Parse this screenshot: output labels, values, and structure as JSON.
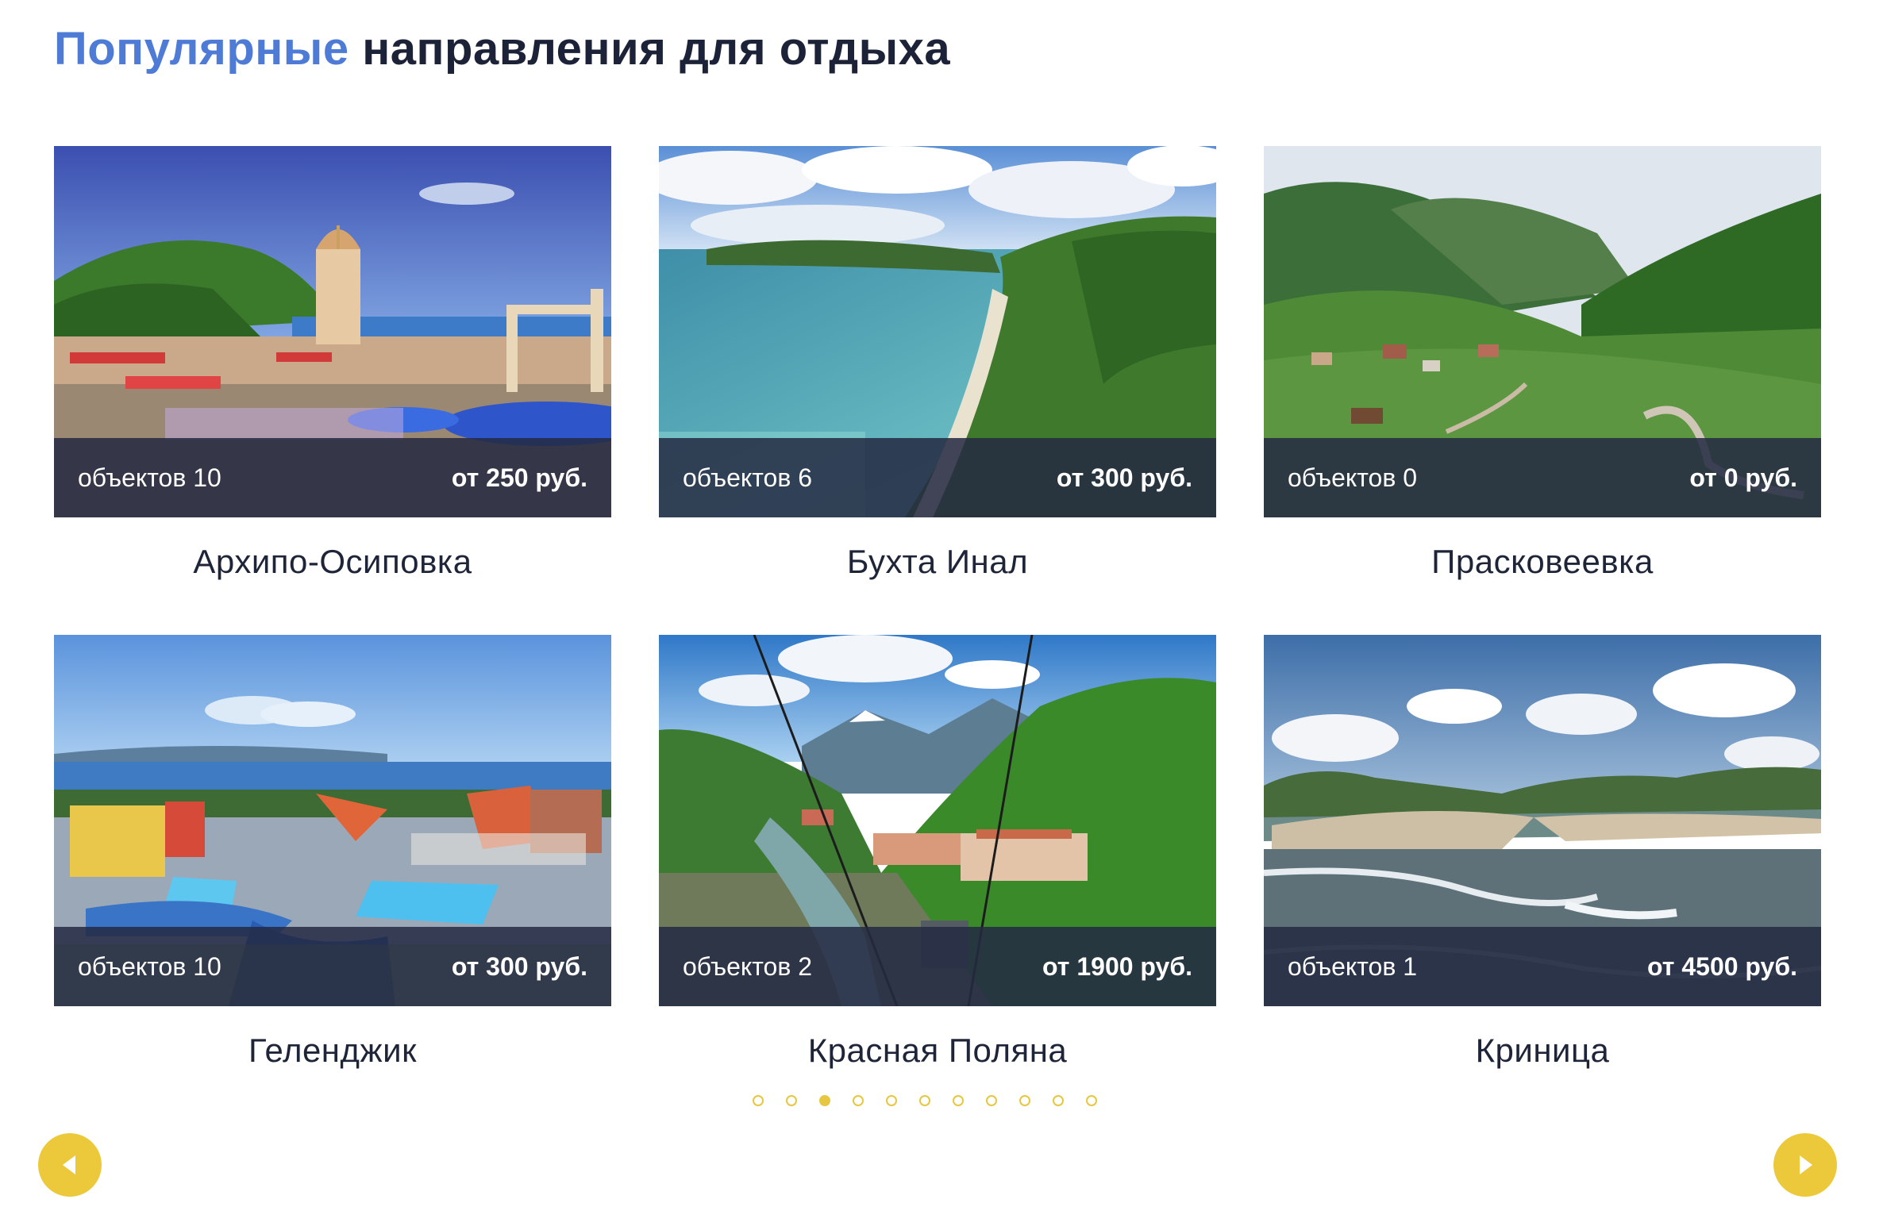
{
  "header": {
    "title_accent": "Популярные",
    "title_rest": "направления для отдыха"
  },
  "destinations": [
    {
      "name": "Архипо-Осиповка",
      "count": "объектов 10",
      "price": "от 250 руб.",
      "image": "seaside-chapel-resort-photo"
    },
    {
      "name": "Бухта Инал",
      "count": "объектов 6",
      "price": "от 300 руб.",
      "image": "turquoise-bay-coastline-photo"
    },
    {
      "name": "Прасковеевка",
      "count": "объектов 0",
      "price": "от 0 руб.",
      "image": "green-mountain-valley-village-photo"
    },
    {
      "name": "Геленджик",
      "count": "объектов 10",
      "price": "от 300 руб.",
      "image": "aquapark-by-the-sea-photo"
    },
    {
      "name": "Красная Поляна",
      "count": "объектов 2",
      "price": "от 1900 руб.",
      "image": "cable-car-mountain-resort-photo"
    },
    {
      "name": "Криница",
      "count": "объектов 1",
      "price": "от 4500 руб.",
      "image": "river-mouth-sea-clouds-photo"
    }
  ],
  "pagination": {
    "total": 11,
    "active_index": 2
  },
  "navigation": {
    "prev_icon": "triangle-left-icon",
    "next_icon": "triangle-right-icon"
  },
  "colors": {
    "accent_blue": "#4d7bd6",
    "dark_text": "#1c2238",
    "yellow": "#ecc93b",
    "overlay": "#242a42"
  }
}
